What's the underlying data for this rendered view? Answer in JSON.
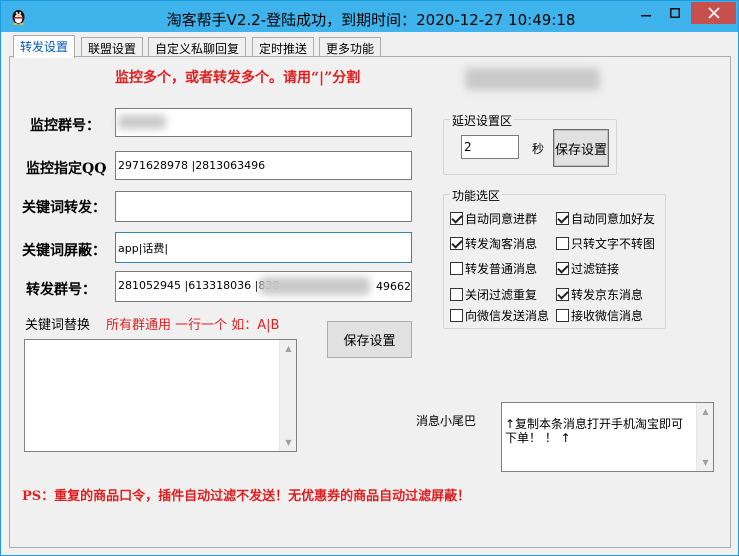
{
  "window": {
    "title": "淘客帮手V2.2-登陆成功，到期时间：2020-12-27 10:49:18"
  },
  "tabs": [
    {
      "label": "转发设置"
    },
    {
      "label": "联盟设置"
    },
    {
      "label": "自定义私聊回复"
    },
    {
      "label": "定时推送"
    },
    {
      "label": "更多功能"
    }
  ],
  "hint_top": "监控多个，或者转发多个。请用“|”分割",
  "fields": {
    "monitor_group": {
      "label": "监控群号：",
      "value": ""
    },
    "monitor_qq": {
      "label": "监控指定QQ",
      "value": "2971628978 |2813063496"
    },
    "keyword_forward": {
      "label": "关键词转发：",
      "value": ""
    },
    "keyword_block": {
      "label": "关键词屏蔽：",
      "value": "app|话费|"
    },
    "forward_group": {
      "label": "转发群号：",
      "value_left": "281052945 |613318036 |838",
      "value_right": "49662"
    }
  },
  "replace": {
    "label": "关键词替换",
    "hint": "所有群通用 一行一个 如：A|B",
    "value": ""
  },
  "save_button": "保存设置",
  "delay": {
    "title": "延迟设置区",
    "value": "2",
    "unit": "秒",
    "save_button": "保存设置"
  },
  "functions": {
    "title": "功能选区",
    "items": [
      {
        "label": "自动同意进群",
        "checked": true
      },
      {
        "label": "自动同意加好友",
        "checked": true
      },
      {
        "label": "转发淘客消息",
        "checked": true
      },
      {
        "label": "只转文字不转图",
        "checked": false
      },
      {
        "label": "转发普通消息",
        "checked": false
      },
      {
        "label": "过滤链接",
        "checked": true
      },
      {
        "label": "关闭过滤重复",
        "checked": false
      },
      {
        "label": "转发京东消息",
        "checked": true
      },
      {
        "label": "向微信发送消息",
        "checked": false
      },
      {
        "label": "接收微信消息",
        "checked": false
      }
    ]
  },
  "tail": {
    "label": "消息小尾巴",
    "value": "↑复制本条消息打开手机淘宝即可下单！ ！ ↑"
  },
  "footer_note": "PS：重复的商品口令，插件自动过滤不发送！无优惠券的商品自动过滤屏蔽！",
  "colors": {
    "titlebar": "#3fb4ec",
    "close_button": "#c7504c",
    "accent_red": "#e02020",
    "active_tab_text": "#0058c6"
  }
}
